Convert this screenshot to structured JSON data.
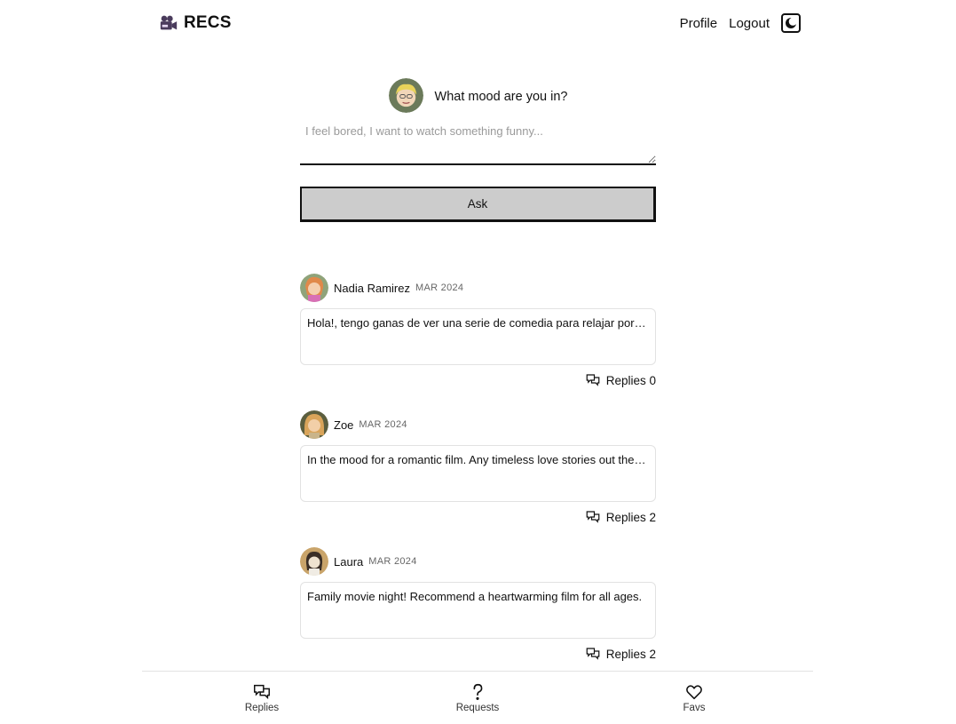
{
  "header": {
    "brand": "RECS",
    "profile_label": "Profile",
    "logout_label": "Logout"
  },
  "ask": {
    "title": "What mood are you in?",
    "placeholder": "I feel bored, I want to watch something funny...",
    "button_label": "Ask"
  },
  "posts": [
    {
      "author": "Nadia Ramirez",
      "date": "MAR 2024",
      "text": "Hola!, tengo ganas de ver una serie de comedia para relajar por la noche",
      "replies_label": "Replies 0"
    },
    {
      "author": "Zoe",
      "date": "MAR 2024",
      "text": "In the mood for a romantic film. Any timeless love stories out there?",
      "replies_label": "Replies 2"
    },
    {
      "author": "Laura",
      "date": "MAR 2024",
      "text": "Family movie night! Recommend a heartwarming film for all ages.",
      "replies_label": "Replies 2"
    }
  ],
  "bottom_nav": {
    "replies_label": "Replies",
    "requests_label": "Requests",
    "favs_label": "Favs"
  },
  "icons": {
    "brand": "movie-camera-icon",
    "theme": "moon-icon",
    "replies": "chat-bubbles-icon",
    "requests": "question-icon",
    "favs": "heart-icon"
  },
  "colors": {
    "button_bg": "#cccccc",
    "text": "#111111",
    "border": "#e2e2e2"
  }
}
